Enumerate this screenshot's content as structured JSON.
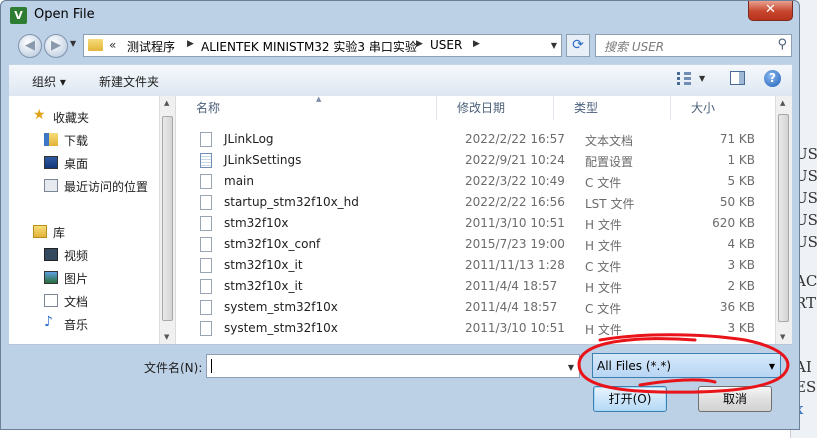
{
  "window": {
    "title": "Open File",
    "close_glyph": "✕",
    "app_icon_letter": "V"
  },
  "background_app": {
    "chars": [
      "US",
      "US",
      "US",
      "US",
      "US",
      "AC",
      "RT",
      "AI",
      "ES",
      "x"
    ]
  },
  "address_bar": {
    "back_glyph": "◀",
    "forward_glyph": "▶",
    "prefix": "«",
    "crumbs": [
      "测试程序",
      "ALIENTEK MINISTM32 实验3 串口实验",
      "USER"
    ],
    "refresh_glyph": "⟳"
  },
  "search": {
    "placeholder": "搜索 USER",
    "icon": "search-icon"
  },
  "toolbar": {
    "organize_label": "组织 ▾",
    "new_folder_label": "新建文件夹",
    "help_glyph": "?"
  },
  "nav_pane": {
    "favorites": {
      "label": "收藏夹",
      "items": [
        {
          "label": "下载",
          "icon": "downloads-icon"
        },
        {
          "label": "桌面",
          "icon": "desktop-icon"
        },
        {
          "label": "最近访问的位置",
          "icon": "recent-places-icon"
        }
      ]
    },
    "libraries": {
      "label": "库",
      "items": [
        {
          "label": "视频",
          "icon": "videos-icon"
        },
        {
          "label": "图片",
          "icon": "pictures-icon"
        },
        {
          "label": "文档",
          "icon": "documents-icon"
        },
        {
          "label": "音乐",
          "icon": "music-icon"
        }
      ]
    }
  },
  "file_list": {
    "columns": {
      "name": "名称",
      "modified": "修改日期",
      "type": "类型",
      "size": "大小"
    },
    "rows": [
      {
        "name": "JLinkLog",
        "modified": "2022/2/22 16:57",
        "type": "文本文档",
        "size": "71 KB",
        "icon": "text-file-icon"
      },
      {
        "name": "JLinkSettings",
        "modified": "2022/9/21 10:24",
        "type": "配置设置",
        "size": "1 KB",
        "icon": "config-file-icon"
      },
      {
        "name": "main",
        "modified": "2022/3/22 10:49",
        "type": "C 文件",
        "size": "5 KB",
        "icon": "file-icon"
      },
      {
        "name": "startup_stm32f10x_hd",
        "modified": "2022/2/22 16:56",
        "type": "LST 文件",
        "size": "50 KB",
        "icon": "file-icon"
      },
      {
        "name": "stm32f10x",
        "modified": "2011/3/10 10:51",
        "type": "H 文件",
        "size": "620 KB",
        "icon": "file-icon"
      },
      {
        "name": "stm32f10x_conf",
        "modified": "2015/7/23 19:00",
        "type": "H 文件",
        "size": "4 KB",
        "icon": "file-icon"
      },
      {
        "name": "stm32f10x_it",
        "modified": "2011/11/13 1:28",
        "type": "C 文件",
        "size": "3 KB",
        "icon": "file-icon"
      },
      {
        "name": "stm32f10x_it",
        "modified": "2011/4/4 18:57",
        "type": "H 文件",
        "size": "2 KB",
        "icon": "file-icon"
      },
      {
        "name": "system_stm32f10x",
        "modified": "2011/4/4 18:57",
        "type": "C 文件",
        "size": "36 KB",
        "icon": "file-icon"
      },
      {
        "name": "system_stm32f10x",
        "modified": "2011/3/10 10:51",
        "type": "H 文件",
        "size": "3 KB",
        "icon": "file-icon"
      }
    ]
  },
  "footer": {
    "filename_label": "文件名(N):",
    "filename_value": "",
    "file_type": "All Files (*.*)",
    "open_label": "打开(O)",
    "cancel_label": "取消"
  },
  "colors": {
    "frame": "#bcd0e6",
    "selected_type": "#b7d5f3",
    "annotation": "#e8141a"
  }
}
